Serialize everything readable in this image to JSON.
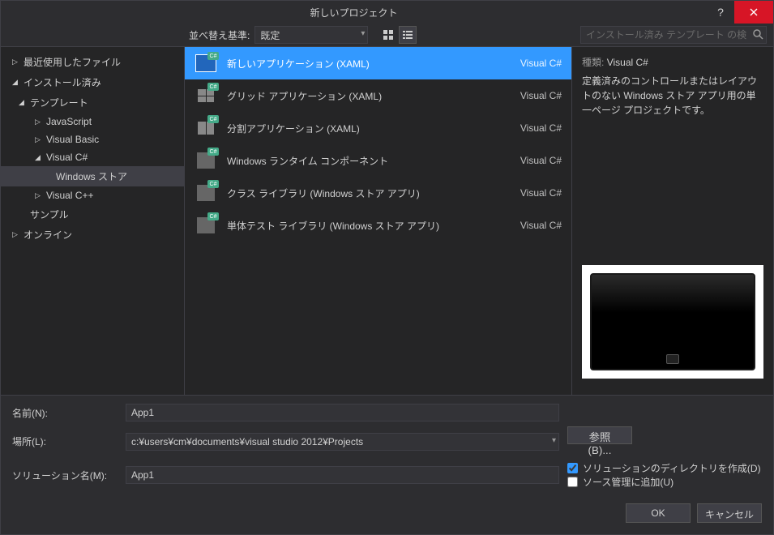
{
  "window": {
    "title": "新しいプロジェクト"
  },
  "sort": {
    "label": "並べ替え基準:",
    "value": "既定"
  },
  "search": {
    "placeholder": "インストール済み テンプレート の検索 (Ctrl"
  },
  "tree": {
    "recent": "最近使用したファイル",
    "installed": "インストール済み",
    "templates": "テンプレート",
    "javascript": "JavaScript",
    "visualbasic": "Visual Basic",
    "visualcsharp": "Visual C#",
    "winstore": "Windows ストア",
    "visualcpp": "Visual C++",
    "samples": "サンプル",
    "online": "オンライン"
  },
  "templates": [
    {
      "name": "新しいアプリケーション (XAML)",
      "lang": "Visual C#",
      "icon": "blank"
    },
    {
      "name": "グリッド アプリケーション (XAML)",
      "lang": "Visual C#",
      "icon": "grid"
    },
    {
      "name": "分割アプリケーション (XAML)",
      "lang": "Visual C#",
      "icon": "split"
    },
    {
      "name": "Windows ランタイム コンポーネント",
      "lang": "Visual C#",
      "icon": "comp"
    },
    {
      "name": "クラス ライブラリ (Windows ストア アプリ)",
      "lang": "Visual C#",
      "icon": "lib"
    },
    {
      "name": "単体テスト ライブラリ (Windows ストア アプリ)",
      "lang": "Visual C#",
      "icon": "test"
    }
  ],
  "details": {
    "type_label": "種類:",
    "type_value": "Visual C#",
    "description": "定義済みのコントロールまたはレイアウトのない Windows ストア アプリ用の単一ページ プロジェクトです。"
  },
  "form": {
    "name_label": "名前(N):",
    "name_value": "App1",
    "location_label": "場所(L):",
    "location_value": "c:¥users¥cm¥documents¥visual studio 2012¥Projects",
    "browse": "参照(B)...",
    "solution_label": "ソリューション名(M):",
    "solution_value": "App1",
    "create_dir": "ソリューションのディレクトリを作成(D)",
    "add_scm": "ソース管理に追加(U)"
  },
  "buttons": {
    "ok": "OK",
    "cancel": "キャンセル"
  }
}
